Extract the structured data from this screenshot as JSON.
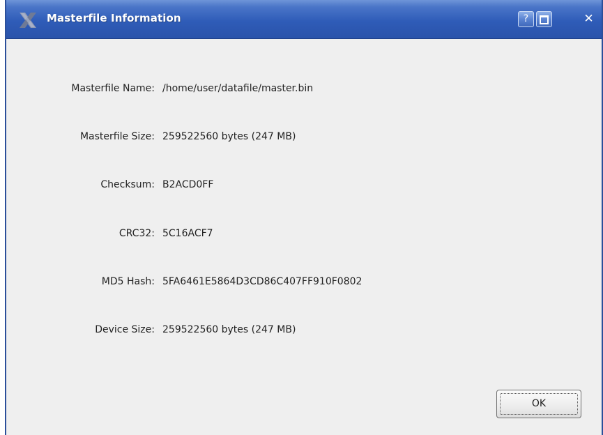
{
  "window": {
    "title": "Masterfile Information",
    "help_glyph": "?",
    "close_glyph": "✕"
  },
  "info_rows": [
    {
      "label": "Masterfile Name:",
      "value": "/home/user/datafile/master.bin"
    },
    {
      "label": "Masterfile Size:",
      "value": "259522560 bytes (247 MB)"
    },
    {
      "label": "Checksum:",
      "value": "B2ACD0FF"
    },
    {
      "label": "CRC32:",
      "value": "5C16ACF7"
    },
    {
      "label": "MD5 Hash:",
      "value": "5FA6461E5864D3CD86C407FF910F0802"
    },
    {
      "label": "Device Size:",
      "value": "259522560 bytes (247 MB)"
    }
  ],
  "buttons": {
    "ok_label": "OK"
  },
  "colors": {
    "titlebar": "#2f5cb8",
    "window_bg": "#efefef"
  },
  "icons": {
    "app": "x-logo-icon",
    "help": "help-icon",
    "maximize": "maximize-icon",
    "close": "close-icon"
  }
}
